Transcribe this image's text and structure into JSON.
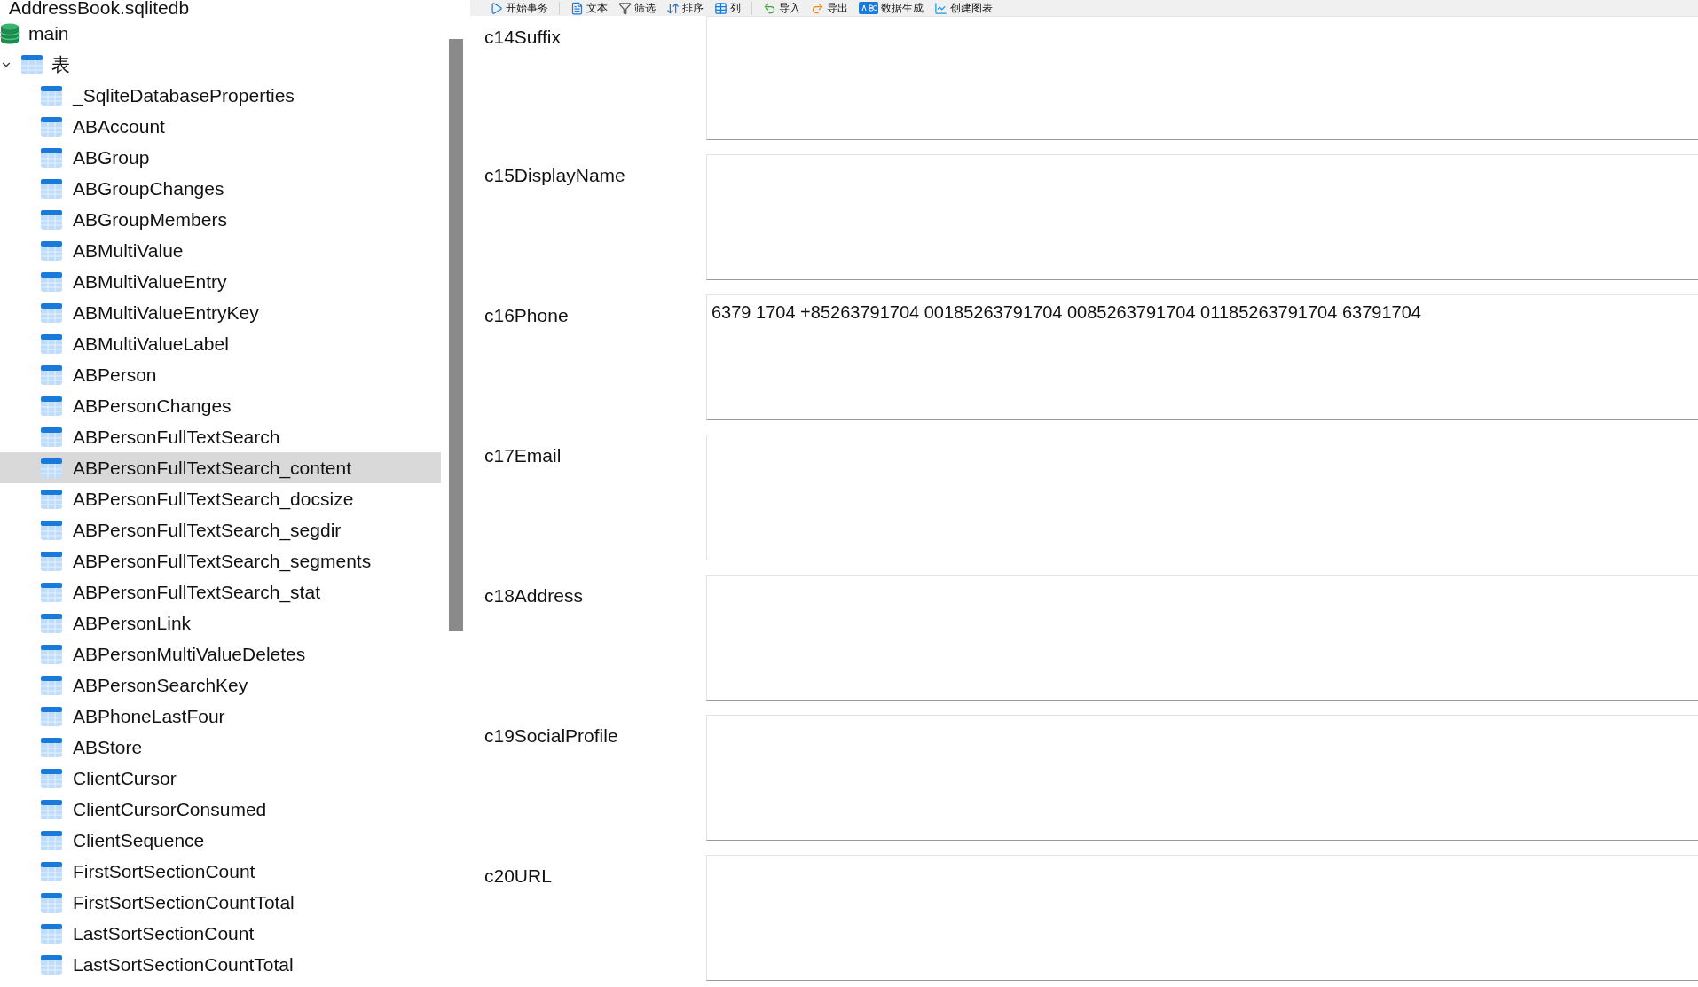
{
  "sidebar": {
    "database": "AddressBook.sqlitedb",
    "schema": {
      "label": "main",
      "expanded": true
    },
    "folder": {
      "label": "表",
      "expanded": true
    },
    "items": [
      {
        "label": "_SqliteDatabaseProperties",
        "selected": false
      },
      {
        "label": "ABAccount",
        "selected": false
      },
      {
        "label": "ABGroup",
        "selected": false
      },
      {
        "label": "ABGroupChanges",
        "selected": false
      },
      {
        "label": "ABGroupMembers",
        "selected": false
      },
      {
        "label": "ABMultiValue",
        "selected": false
      },
      {
        "label": "ABMultiValueEntry",
        "selected": false
      },
      {
        "label": "ABMultiValueEntryKey",
        "selected": false
      },
      {
        "label": "ABMultiValueLabel",
        "selected": false
      },
      {
        "label": "ABPerson",
        "selected": false
      },
      {
        "label": "ABPersonChanges",
        "selected": false
      },
      {
        "label": "ABPersonFullTextSearch",
        "selected": false
      },
      {
        "label": "ABPersonFullTextSearch_content",
        "selected": true
      },
      {
        "label": "ABPersonFullTextSearch_docsize",
        "selected": false
      },
      {
        "label": "ABPersonFullTextSearch_segdir",
        "selected": false
      },
      {
        "label": "ABPersonFullTextSearch_segments",
        "selected": false
      },
      {
        "label": "ABPersonFullTextSearch_stat",
        "selected": false
      },
      {
        "label": "ABPersonLink",
        "selected": false
      },
      {
        "label": "ABPersonMultiValueDeletes",
        "selected": false
      },
      {
        "label": "ABPersonSearchKey",
        "selected": false
      },
      {
        "label": "ABPhoneLastFour",
        "selected": false
      },
      {
        "label": "ABStore",
        "selected": false
      },
      {
        "label": "ClientCursor",
        "selected": false
      },
      {
        "label": "ClientCursorConsumed",
        "selected": false
      },
      {
        "label": "ClientSequence",
        "selected": false
      },
      {
        "label": "FirstSortSectionCount",
        "selected": false
      },
      {
        "label": "FirstSortSectionCountTotal",
        "selected": false
      },
      {
        "label": "LastSortSectionCount",
        "selected": false
      },
      {
        "label": "LastSortSectionCountTotal",
        "selected": false
      }
    ]
  },
  "toolbar": {
    "groups": [
      [
        {
          "kind": "transaction",
          "label": "开始事务"
        }
      ],
      [
        {
          "kind": "text",
          "label": "文本"
        },
        {
          "kind": "filter",
          "label": "筛选"
        },
        {
          "kind": "sort",
          "label": "排序"
        },
        {
          "kind": "columns",
          "label": "列"
        }
      ],
      [
        {
          "kind": "import",
          "label": "导入"
        },
        {
          "kind": "export",
          "label": "导出"
        },
        {
          "kind": "generate",
          "label": "数据生成"
        },
        {
          "kind": "chart",
          "label": "创建图表"
        }
      ]
    ]
  },
  "form": {
    "fields": [
      {
        "label": "c14Suffix"
      },
      {
        "label": "c15DisplayName"
      },
      {
        "label": "c16Phone",
        "value": "6379 1704 +85263791704 00185263791704 0085263791704 01185263791704 63791704"
      },
      {
        "label": "c17Email"
      },
      {
        "label": "c18Address"
      },
      {
        "label": "c19SocialProfile"
      },
      {
        "label": "c20URL"
      }
    ]
  }
}
